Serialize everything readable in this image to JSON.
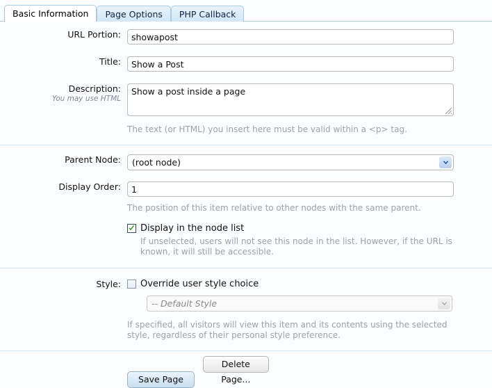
{
  "tabs": [
    {
      "label": "Basic Information",
      "active": true
    },
    {
      "label": "Page Options",
      "active": false
    },
    {
      "label": "PHP Callback",
      "active": false
    }
  ],
  "form": {
    "url_portion": {
      "label": "URL Portion:",
      "value": "showapost"
    },
    "title": {
      "label": "Title:",
      "value": "Show a Post"
    },
    "description": {
      "label": "Description:",
      "sublabel": "You may use HTML",
      "value": "Show a post inside a page",
      "hint": "The text (or HTML) you insert here must be valid within a <p> tag."
    },
    "parent_node": {
      "label": "Parent Node:",
      "value": "(root node)",
      "arrow_icon": "chevron-down-icon"
    },
    "display_order": {
      "label": "Display Order:",
      "value": "1",
      "hint": "The position of this item relative to other nodes with the same parent."
    },
    "display_in_node_list": {
      "label": "Display in the node list",
      "checked": true,
      "hint": "If unselected, users will not see this node in the list. However, if the URL is known, it will still be accessible."
    },
    "style": {
      "label": "Style:",
      "override_label": "Override user style choice",
      "override_checked": false,
      "select_value": "-- Default Style",
      "select_disabled": true,
      "arrow_icon": "chevron-down-icon",
      "hint": "If specified, all visitors will view this item and its contents using the selected style, regardless of their personal style preference."
    }
  },
  "actions": {
    "save_label": "Save Page",
    "delete_label": "Delete Page..."
  },
  "colors": {
    "tab_border": "#a9cce3",
    "divider": "#d7e8f4",
    "page_bg": "#fbfcfe",
    "hint_text": "#9aa3ab",
    "check_green": "#3a9c2e",
    "primary_button": "#c8dff1"
  }
}
